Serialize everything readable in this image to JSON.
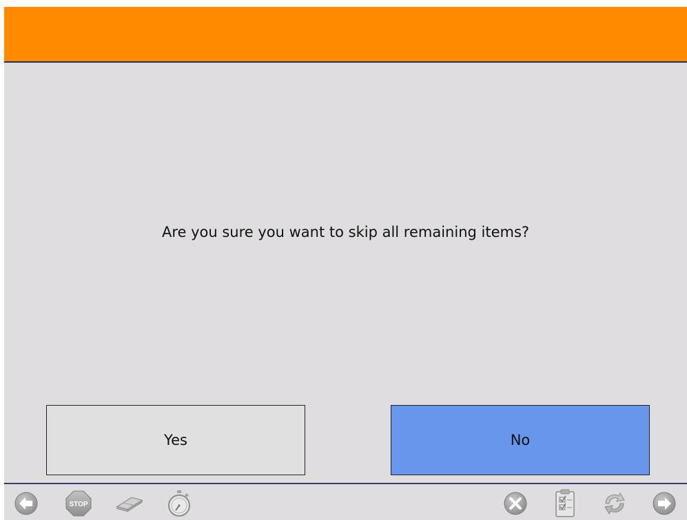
{
  "dialog": {
    "prompt": "Are you sure you want to skip all remaining items?",
    "yes_label": "Yes",
    "no_label": "No"
  },
  "toolbar": {
    "stop_label": "STOP",
    "icons_left": [
      "back-arrow-icon",
      "stop-sign-icon",
      "eraser-icon",
      "stopwatch-icon"
    ],
    "icons_right": [
      "cancel-icon",
      "checklist-icon",
      "refresh-icon",
      "forward-arrow-icon"
    ]
  },
  "colors": {
    "header": "#ff8a00",
    "background": "#dfdde0",
    "yes_button": "#e0e0e0",
    "no_button": "#6896ec",
    "divider": "#2a2a55",
    "icon_gray": "#9a9a9a"
  }
}
